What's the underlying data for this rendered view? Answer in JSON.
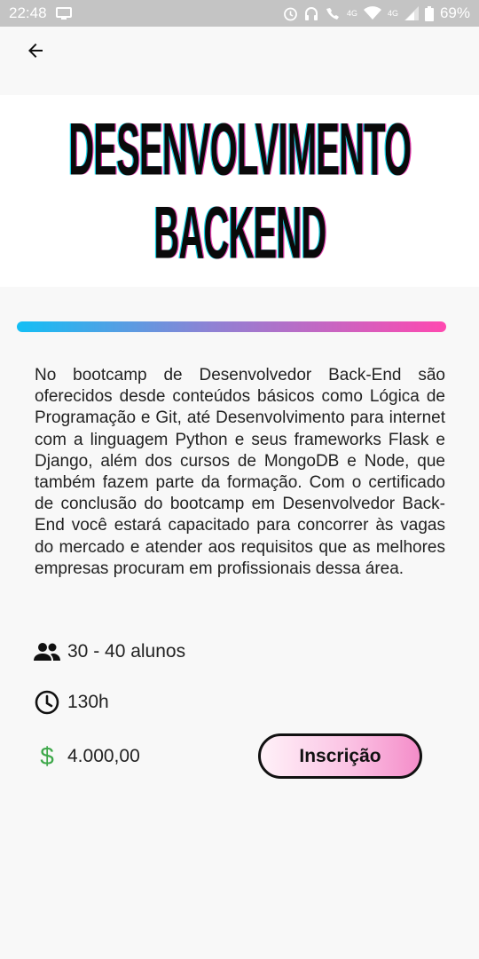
{
  "status_bar": {
    "time": "22:48",
    "network_label": "4G",
    "network_label_2": "4G",
    "battery": "69%"
  },
  "app_bar": {
    "back_icon": "arrow-left-icon"
  },
  "banner": {
    "line1": "DESENVOLVIMENTO",
    "line2": "BACKEND"
  },
  "course": {
    "description": "No bootcamp de Desenvolvedor Back-End são oferecidos desde conteúdos básicos como Lógica de Programação e Git, até Desenvolvimento para internet com a linguagem Python e seus frameworks Flask e Django, além dos cursos de MongoDB e Node, que também fazem parte da formação. Com o certificado de conclusão do bootcamp em Desenvolvedor Back-End você estará capacitado para concorrer às vagas do mercado e atender aos requisitos que as melhores empresas procuram em profissionais dessa área.",
    "students": "30 - 40 alunos",
    "hours": "130h",
    "price_symbol": "$",
    "price": "4.000,00",
    "enroll_label": "Inscrição"
  },
  "colors": {
    "status_bar_bg": "#c4c4c4",
    "gradient_start": "#13bff5",
    "gradient_end": "#ff49b0",
    "price_icon": "#3ea84a",
    "button_fill": "#f48dc9"
  }
}
